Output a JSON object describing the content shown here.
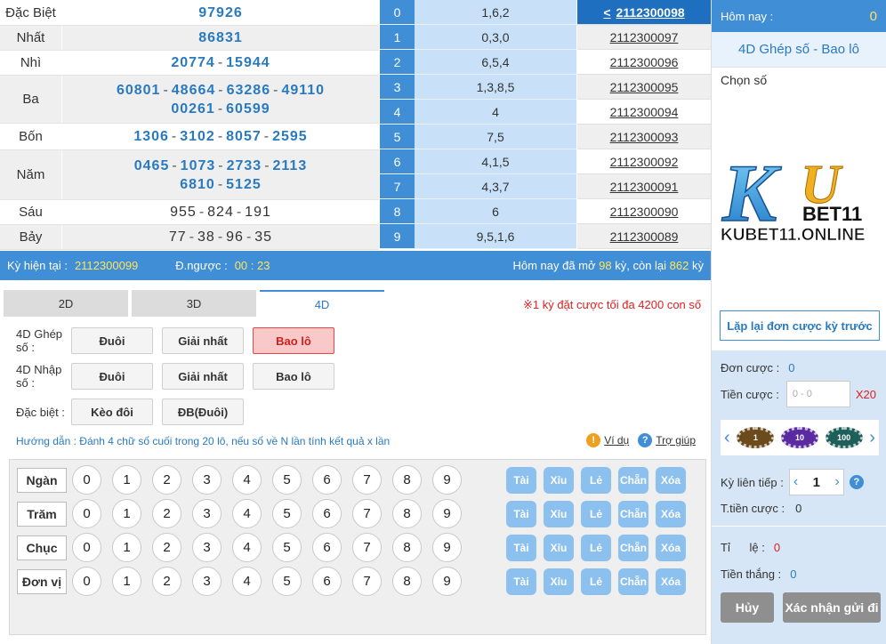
{
  "results": {
    "rows": [
      {
        "prize": "Đặc Biệt",
        "lines": [
          [
            "97926"
          ]
        ]
      },
      {
        "prize": "Nhất",
        "lines": [
          [
            "86831"
          ]
        ]
      },
      {
        "prize": "Nhì",
        "lines": [
          [
            "20774",
            "15944"
          ]
        ]
      },
      {
        "prize": "Ba",
        "lines": [
          [
            "60801",
            "48664",
            "63286",
            "49110"
          ],
          [
            "00261",
            "60599"
          ]
        ]
      },
      {
        "prize": "Bốn",
        "lines": [
          [
            "1306",
            "3102",
            "8057",
            "2595"
          ]
        ]
      },
      {
        "prize": "Năm",
        "lines": [
          [
            "0465",
            "1073",
            "2733",
            "2113"
          ],
          [
            "6810",
            "5125"
          ]
        ]
      },
      {
        "prize": "Sáu",
        "lines": [
          [
            "955",
            "824",
            "191"
          ]
        ]
      },
      {
        "prize": "Bảy",
        "lines": [
          [
            "77",
            "38",
            "96",
            "35"
          ]
        ]
      }
    ]
  },
  "headtail": [
    {
      "digit": "0",
      "values": "1,6,2"
    },
    {
      "digit": "1",
      "values": "0,3,0"
    },
    {
      "digit": "2",
      "values": "6,5,4"
    },
    {
      "digit": "3",
      "values": "1,3,8,5"
    },
    {
      "digit": "4",
      "values": "4"
    },
    {
      "digit": "5",
      "values": "7,5"
    },
    {
      "digit": "6",
      "values": "4,1,5"
    },
    {
      "digit": "7",
      "values": "4,3,7"
    },
    {
      "digit": "8",
      "values": "6"
    },
    {
      "digit": "9",
      "values": "9,5,1,6"
    }
  ],
  "periods": [
    "2112300098",
    "2112300097",
    "2112300096",
    "2112300095",
    "2112300094",
    "2112300093",
    "2112300092",
    "2112300091",
    "2112300090",
    "2112300089"
  ],
  "status": {
    "current_label": "Kỳ hiện tại :",
    "current_value": "2112300099",
    "countdown_label": "Đ.ngược :",
    "countdown_value": "00 : 23",
    "today_prefix": "Hôm nay đã mở",
    "opened": "98",
    "mid": "kỳ, còn lại",
    "remaining": "862",
    "suffix": "kỳ"
  },
  "tabs": [
    "2D",
    "3D",
    "4D"
  ],
  "notice": "※1 kỳ đặt cược tối đa 4200 con số",
  "bet_types": [
    {
      "label": "4D Ghép số :",
      "buttons": [
        "Đuôi",
        "Giải nhất",
        "Bao lô"
      ]
    },
    {
      "label": "4D Nhập số :",
      "buttons": [
        "Đuôi",
        "Giải nhất",
        "Bao lô"
      ]
    },
    {
      "label": "Đặc biệt :",
      "buttons": [
        "Kèo đôi",
        "ĐB(Đuôi)"
      ]
    }
  ],
  "guide": "Hướng dẫn : Đánh 4 chữ số cuối trong 20 lô, nếu số về N lần tính kết quả x lần",
  "help": {
    "example": "Ví dụ",
    "help": "Trợ giúp"
  },
  "grid": {
    "positions": [
      "Ngàn",
      "Trăm",
      "Chục",
      "Đơn vị"
    ],
    "digits": [
      "0",
      "1",
      "2",
      "3",
      "4",
      "5",
      "6",
      "7",
      "8",
      "9"
    ],
    "quick": [
      "Tài",
      "Xỉu",
      "Lẻ",
      "Chẵn",
      "Xóa"
    ]
  },
  "panel": {
    "today_label": "Hôm nay :",
    "today_count": "0",
    "bet_type": "4D Ghép số - Bao lô",
    "choose_label": "Chọn số",
    "logo_brand": "KU",
    "logo_bet": "BET11",
    "logo_site": "KUBET11.ONLINE",
    "repeat_button": "Lặp lại đơn cược kỳ trước",
    "order_label": "Đơn cược :",
    "order_value": "0",
    "stake_label": "Tiền cược :",
    "stake_placeholder": "0 - 0",
    "multiplier": "X20",
    "chips": [
      "1",
      "10",
      "100"
    ],
    "consecutive_label": "Kỳ liên tiếp :",
    "consecutive_value": "1",
    "total_label": "T.tiền cược :",
    "total_value": "0",
    "rate_label": "Tỉ      lệ :",
    "rate_value": "0",
    "win_label": "Tiền thắng :",
    "win_value": "0",
    "cancel": "Hủy",
    "submit": "Xác nhận gửi đi"
  },
  "colors": {
    "accent": "#3f8ed6",
    "number": "#2a7abf",
    "selected": "#e04a4a",
    "countdown": "#ffe45c"
  }
}
